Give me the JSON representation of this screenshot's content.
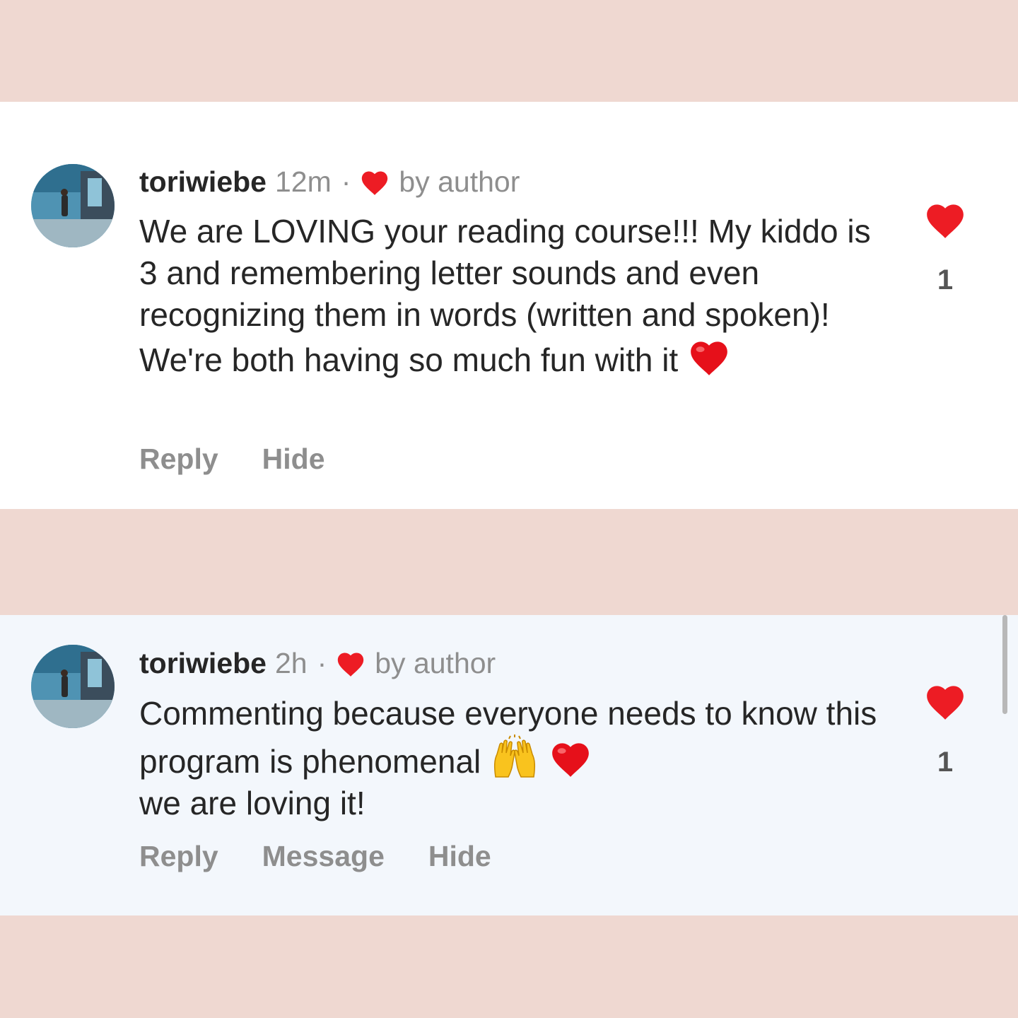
{
  "colors": {
    "page_background": "#efd8d1",
    "card_background": "#ffffff",
    "highlighted_card_background": "#f3f7fc",
    "heart_red": "#ed1c24",
    "muted_text": "#8e8e8e"
  },
  "comments": [
    {
      "avatar_icon": "user-avatar-aquarium-photo",
      "username": "toriwiebe",
      "time": "12m",
      "separator": "·",
      "author_badge_icon": "heart-icon",
      "author_badge_text": "by author",
      "text_parts": [
        "We are LOVING your reading course!!! My kiddo is 3 and remembering letter sounds and even recognizing them in words (written and spoken)! We're both having so much fun with it"
      ],
      "emojis": [
        "red-heart-emoji"
      ],
      "like_icon": "heart-filled-icon",
      "like_count": "1",
      "actions": [
        "Reply",
        "Hide"
      ]
    },
    {
      "avatar_icon": "user-avatar-aquarium-photo",
      "username": "toriwiebe",
      "time": "2h",
      "separator": "·",
      "author_badge_icon": "heart-icon",
      "author_badge_text": "by author",
      "text_parts": [
        "Commenting because everyone needs to know this program is phenomenal",
        "we are loving it!"
      ],
      "emojis": [
        "raising-hands-emoji",
        "red-heart-emoji"
      ],
      "like_icon": "heart-filled-icon",
      "like_count": "1",
      "actions": [
        "Reply",
        "Message",
        "Hide"
      ]
    }
  ]
}
